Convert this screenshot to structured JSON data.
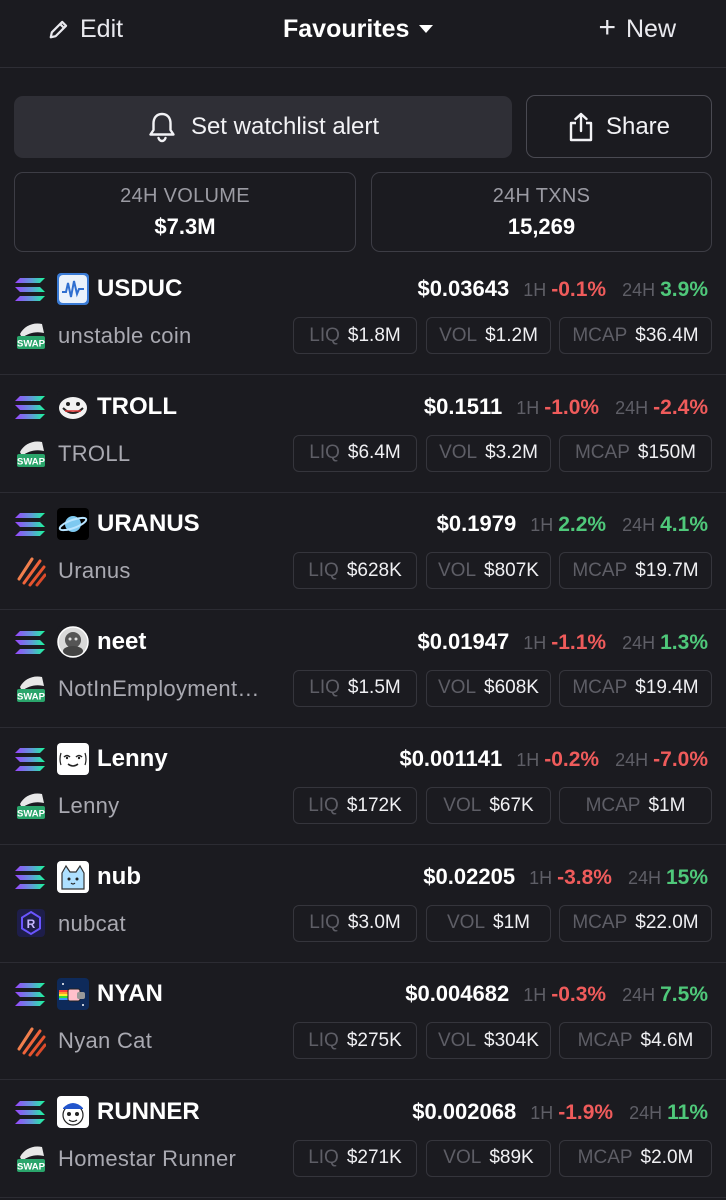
{
  "header": {
    "edit_label": "Edit",
    "title": "Favourites",
    "new_label": "New"
  },
  "actions": {
    "alert_label": "Set watchlist alert",
    "share_label": "Share"
  },
  "stats": {
    "volume_label": "24H VOLUME",
    "volume_value": "$7.3M",
    "txns_label": "24H TXNS",
    "txns_value": "15,269"
  },
  "labels": {
    "h1": "1H",
    "h24": "24H",
    "liq": "LIQ",
    "vol": "VOL",
    "mcap": "MCAP"
  },
  "tokens": [
    {
      "symbol": "USDUC",
      "name": "unstable coin",
      "price": "$0.03643",
      "change_1h": "-0.1%",
      "change_24h": "3.9%",
      "liq": "$1.8M",
      "vol": "$1.2M",
      "mcap": "$36.4M",
      "dex": "swap-icon",
      "avatar": "usduc-logo-icon"
    },
    {
      "symbol": "TROLL",
      "name": "TROLL",
      "price": "$0.1511",
      "change_1h": "-1.0%",
      "change_24h": "-2.4%",
      "liq": "$6.4M",
      "vol": "$3.2M",
      "mcap": "$150M",
      "dex": "swap-icon",
      "avatar": "troll-face-icon"
    },
    {
      "symbol": "URANUS",
      "name": "Uranus",
      "price": "$0.1979",
      "change_1h": "2.2%",
      "change_24h": "4.1%",
      "liq": "$628K",
      "vol": "$807K",
      "mcap": "$19.7M",
      "dex": "meteora-icon",
      "avatar": "planet-icon"
    },
    {
      "symbol": "neet",
      "name": "NotInEmployment…",
      "price": "$0.01947",
      "change_1h": "-1.1%",
      "change_24h": "1.3%",
      "liq": "$1.5M",
      "vol": "$608K",
      "mcap": "$19.4M",
      "dex": "swap-icon",
      "avatar": "neet-avatar-icon"
    },
    {
      "symbol": "Lenny",
      "name": "Lenny",
      "price": "$0.001141",
      "change_1h": "-0.2%",
      "change_24h": "-7.0%",
      "liq": "$172K",
      "vol": "$67K",
      "mcap": "$1M",
      "dex": "swap-icon",
      "avatar": "lenny-face-icon"
    },
    {
      "symbol": "nub",
      "name": "nubcat",
      "price": "$0.02205",
      "change_1h": "-3.8%",
      "change_24h": "15%",
      "liq": "$3.0M",
      "vol": "$1M",
      "mcap": "$22.0M",
      "dex": "raydium-icon",
      "avatar": "cat-icon"
    },
    {
      "symbol": "NYAN",
      "name": "Nyan Cat",
      "price": "$0.004682",
      "change_1h": "-0.3%",
      "change_24h": "7.5%",
      "liq": "$275K",
      "vol": "$304K",
      "mcap": "$4.6M",
      "dex": "meteora-icon",
      "avatar": "nyan-cat-icon"
    },
    {
      "symbol": "RUNNER",
      "name": "Homestar Runner",
      "price": "$0.002068",
      "change_1h": "-1.9%",
      "change_24h": "11%",
      "liq": "$271K",
      "vol": "$89K",
      "mcap": "$2.0M",
      "dex": "swap-icon",
      "avatar": "homestar-icon"
    }
  ],
  "colors": {
    "background": "#1b1b20",
    "negative": "#ef5b5b",
    "positive": "#4fc87a",
    "muted": "#5e5e66"
  }
}
